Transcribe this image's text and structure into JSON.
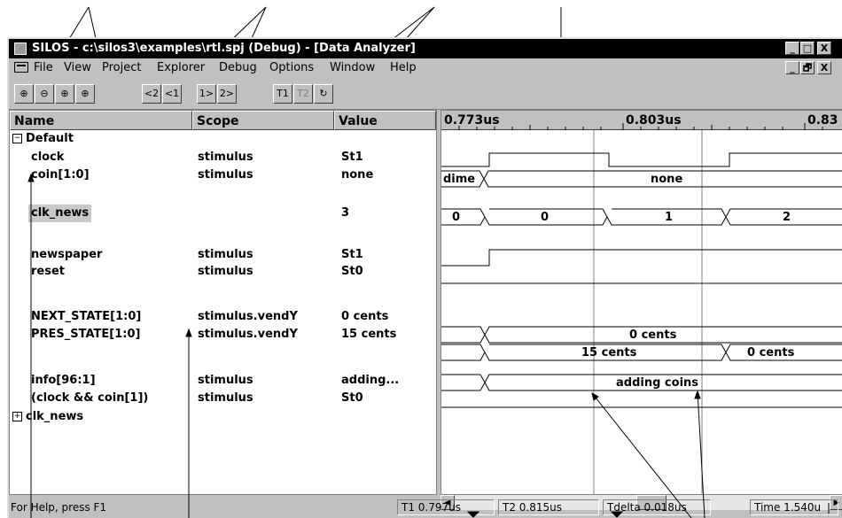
{
  "window": {
    "title": "SILOS - c:\\silos3\\examples\\rtl.spj (Debug) - [Data Analyzer]",
    "controls": [
      "_",
      "□",
      "X"
    ],
    "child_controls": [
      "_",
      "🗗",
      "X"
    ]
  },
  "menu": [
    {
      "label": "File"
    },
    {
      "label": "View"
    },
    {
      "label": "Project"
    },
    {
      "label": "Explorer"
    },
    {
      "label": "Debug"
    },
    {
      "label": "Options"
    },
    {
      "label": "Window"
    },
    {
      "label": "Help"
    }
  ],
  "toolbar": {
    "zoom": [
      "⊕",
      "⊖",
      "⊕",
      "⊕"
    ],
    "step": [
      "<2",
      "<1",
      "1>",
      "2>"
    ],
    "timers": [
      "T1",
      "T2",
      "↻"
    ]
  },
  "columns": {
    "name": "Name",
    "scope": "Scope",
    "value": "Value"
  },
  "signals": [
    {
      "name": "Default",
      "scope": "",
      "value": "",
      "tree": "−"
    },
    {
      "name": "clock",
      "scope": "stimulus",
      "value": "St1"
    },
    {
      "name": "coin[1:0]",
      "scope": "stimulus",
      "value": "none"
    },
    {
      "name": "",
      "scope": "",
      "value": ""
    },
    {
      "name": "clk_news",
      "scope": "",
      "value": "3",
      "selected": true
    },
    {
      "name": "",
      "scope": "",
      "value": ""
    },
    {
      "name": "newspaper",
      "scope": "stimulus",
      "value": "St1"
    },
    {
      "name": "reset",
      "scope": "stimulus",
      "value": "St0"
    },
    {
      "name": "",
      "scope": "",
      "value": ""
    },
    {
      "name": "NEXT_STATE[1:0]",
      "scope": "stimulus.vendY",
      "value": "0 cents"
    },
    {
      "name": "PRES_STATE[1:0]",
      "scope": "stimulus.vendY",
      "value": "15 cents"
    },
    {
      "name": "",
      "scope": "",
      "value": ""
    },
    {
      "name": "info[96:1]",
      "scope": "stimulus",
      "value": "adding..."
    },
    {
      "name": "(clock && coin[1])",
      "scope": "stimulus",
      "value": "St0"
    },
    {
      "name": "clk_news",
      "scope": "",
      "value": "",
      "tree": "+"
    }
  ],
  "timeline": {
    "labels": [
      "0.773us",
      "0.803us",
      "0.83"
    ],
    "waves": {
      "coin": [
        "dime",
        "none"
      ],
      "clk_news": [
        "0",
        "0",
        "1",
        "2"
      ],
      "next_state": [
        "0 cents"
      ],
      "pres_state": [
        "15 cents",
        "0 cents"
      ],
      "info": [
        "adding coins"
      ]
    }
  },
  "status": {
    "help": "For Help, press F1",
    "t1": "T1 0.797us",
    "t2": "T2 0.815us",
    "tdelta": "Tdelta 0.018us",
    "time": "Time 1.540u"
  }
}
